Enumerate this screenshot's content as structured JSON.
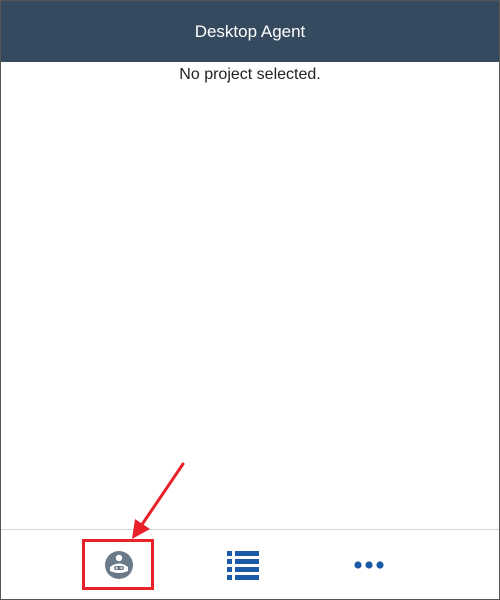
{
  "window": {
    "title": "Desktop Agent"
  },
  "main": {
    "status_text": "No project selected."
  },
  "footer": {
    "buttons": [
      {
        "icon": "agent-avatar-icon",
        "highlighted": true
      },
      {
        "icon": "list-icon",
        "highlighted": false
      },
      {
        "icon": "more-options-icon",
        "highlighted": false
      }
    ]
  },
  "annotation": {
    "highlight_color": "#e8212b"
  },
  "colors": {
    "header_bg": "#354a5f",
    "icon_blue": "#1b5aa6",
    "avatar_gray": "#6b7a89"
  }
}
